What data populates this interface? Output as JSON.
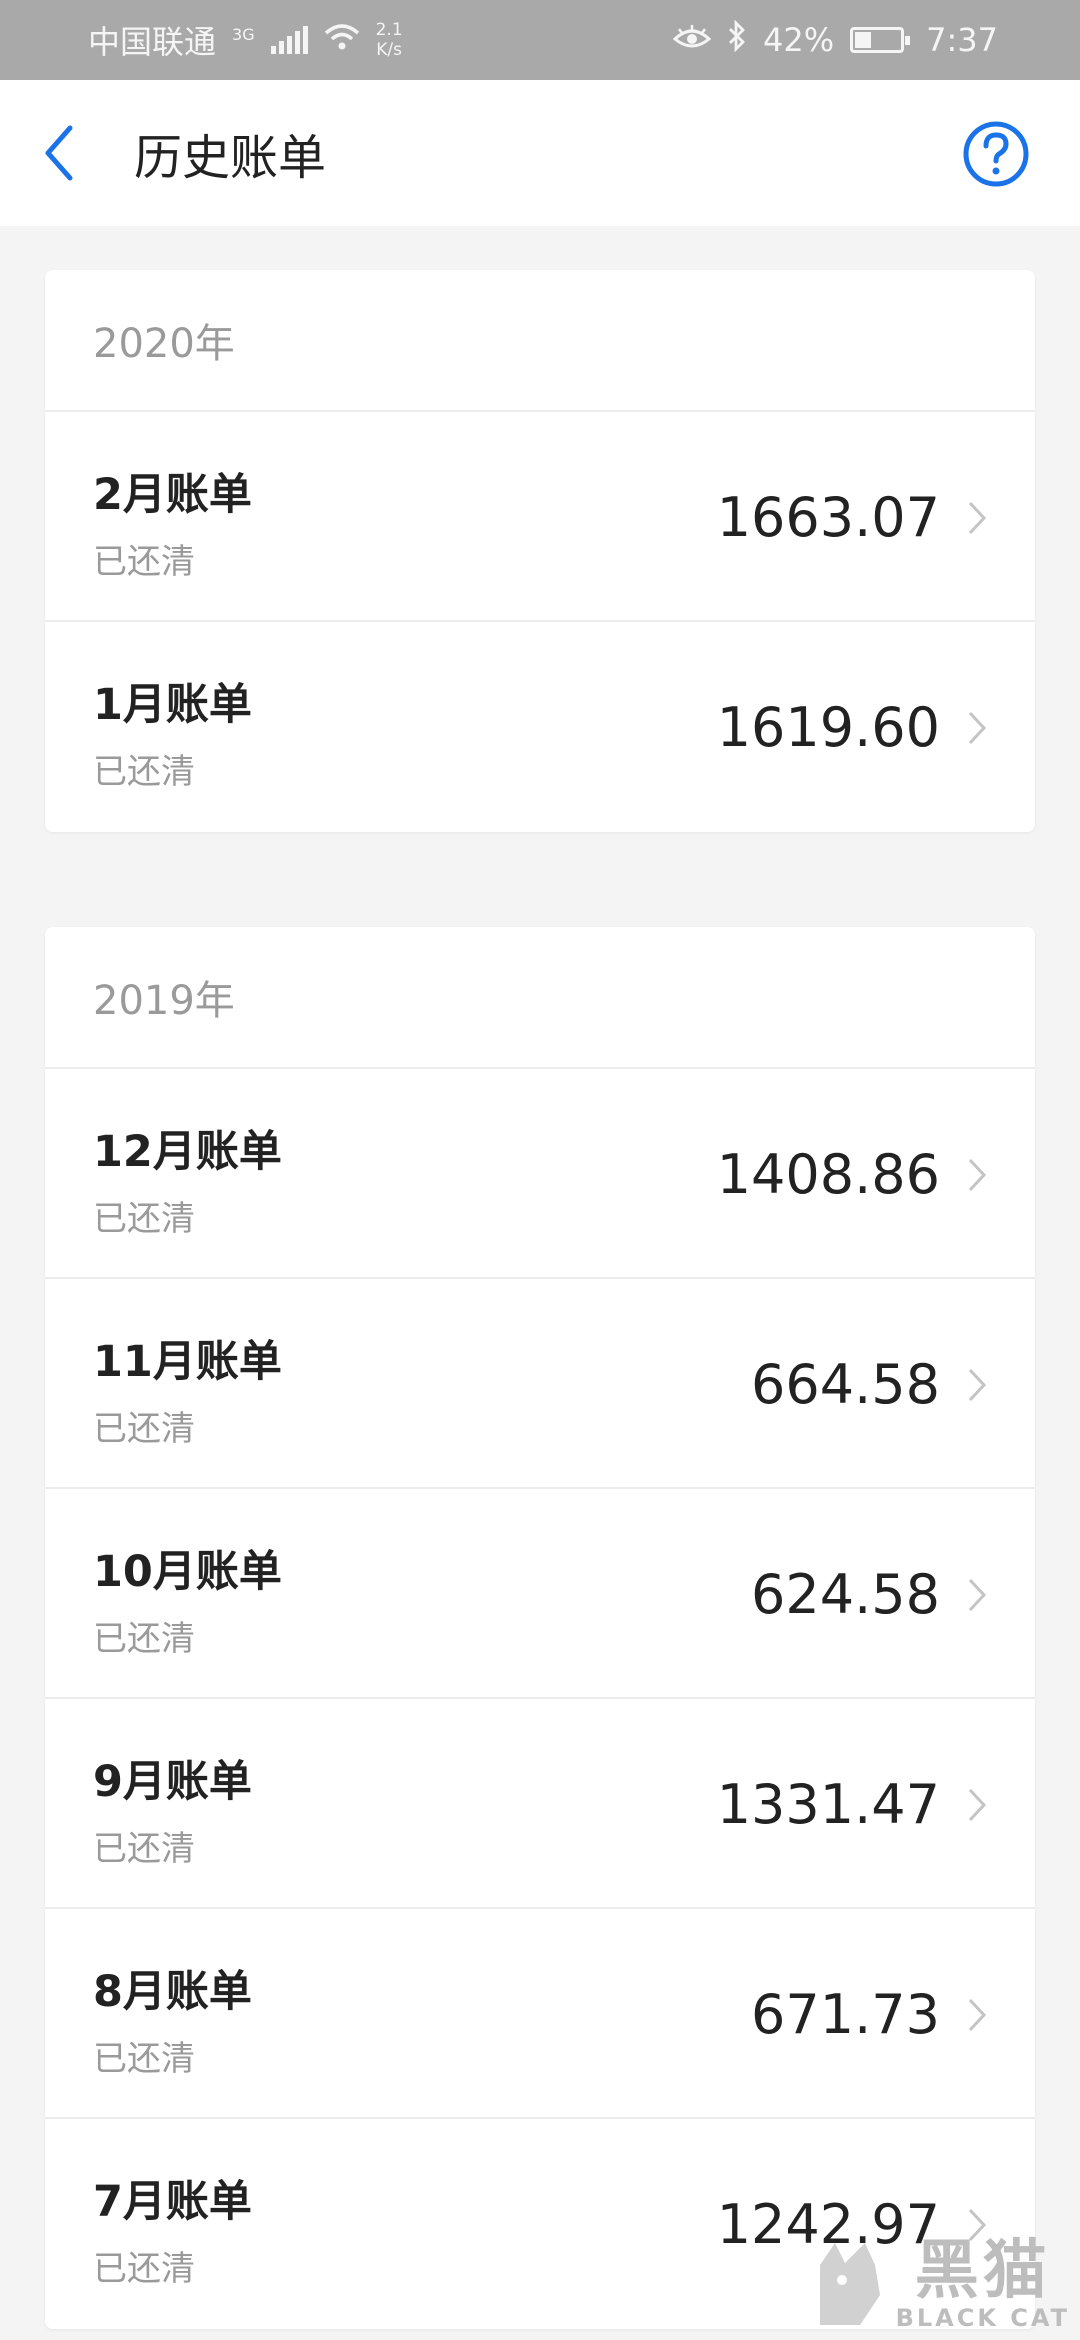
{
  "status_bar": {
    "carrier": "中国联通",
    "network_type": "3G",
    "speed_value": "2.1",
    "speed_unit": "K/s",
    "battery": "42%",
    "battery_level": 0.42,
    "time": "7:37"
  },
  "header": {
    "title": "历史账单"
  },
  "sections": [
    {
      "year": "2020年",
      "bills": [
        {
          "name": "2月账单",
          "status": "已还清",
          "amount": "1663.07"
        },
        {
          "name": "1月账单",
          "status": "已还清",
          "amount": "1619.60"
        }
      ]
    },
    {
      "year": "2019年",
      "bills": [
        {
          "name": "12月账单",
          "status": "已还清",
          "amount": "1408.86"
        },
        {
          "name": "11月账单",
          "status": "已还清",
          "amount": "664.58"
        },
        {
          "name": "10月账单",
          "status": "已还清",
          "amount": "624.58"
        },
        {
          "name": "9月账单",
          "status": "已还清",
          "amount": "1331.47"
        },
        {
          "name": "8月账单",
          "status": "已还清",
          "amount": "671.73"
        },
        {
          "name": "7月账单",
          "status": "已还清",
          "amount": "1242.97"
        }
      ]
    }
  ],
  "watermark": {
    "text_cn": "黑猫",
    "text_en": "BLACK CAT"
  },
  "colors": {
    "accent": "#1a73e8",
    "status_bar_bg": "#a9a9a9",
    "page_bg": "#f4f4f4"
  }
}
